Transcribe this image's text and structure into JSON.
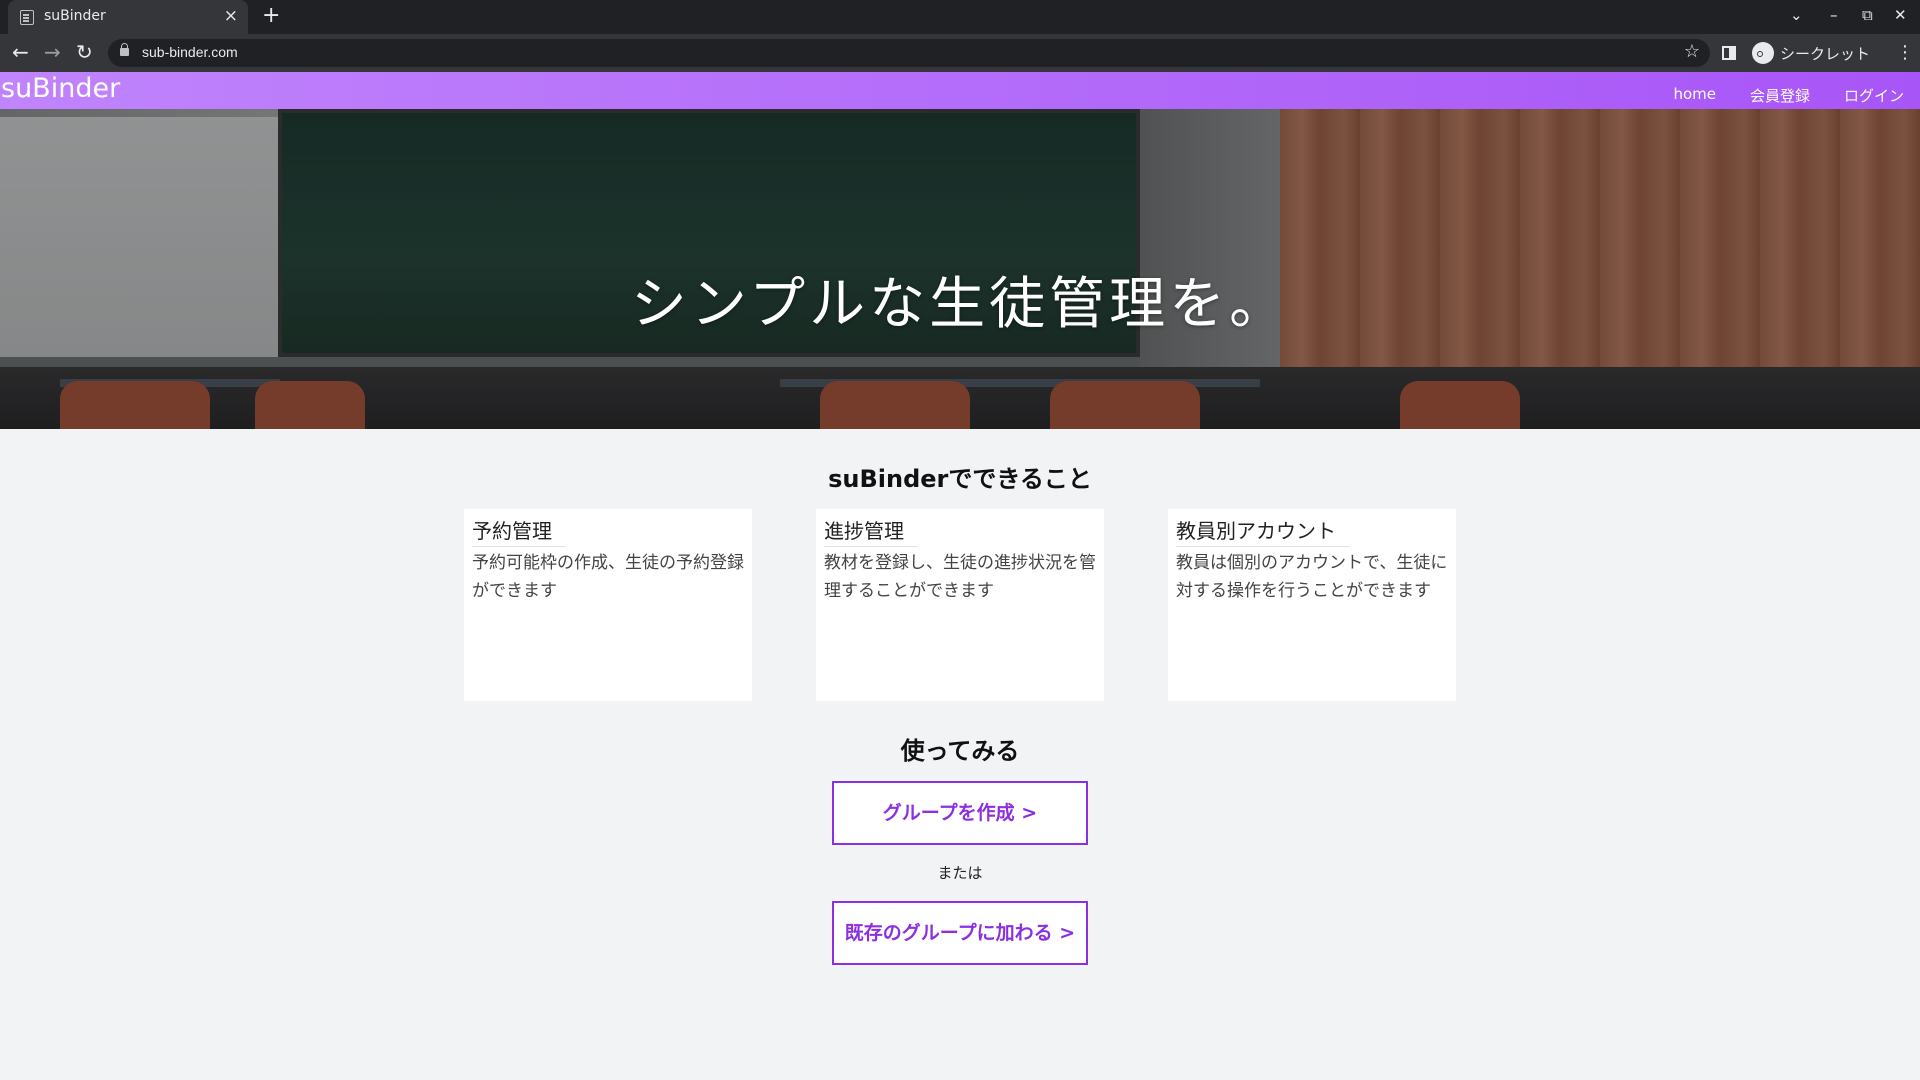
{
  "browser": {
    "tab_title": "suBinder",
    "tab_close": "×",
    "new_tab": "+",
    "url": "sub-binder.com",
    "profile_label": "シークレット",
    "window_controls": {
      "dropdown": "⌄",
      "minimize": "–",
      "restore": "⧉",
      "close": "✕"
    },
    "nav": {
      "back": "←",
      "forward": "→",
      "reload": "↻",
      "star": "☆",
      "menu": "⋮"
    }
  },
  "site": {
    "logo": "suBinder",
    "nav": [
      {
        "label": "home"
      },
      {
        "label": "会員登録"
      },
      {
        "label": "ログイン"
      }
    ],
    "brand_colors": {
      "header_start": "#c084fc",
      "header_end": "#a855f7",
      "accent": "#8b2fe0"
    }
  },
  "hero": {
    "title": "シンプルな生徒管理を。"
  },
  "features": {
    "title": "suBinderでできること",
    "cards": [
      {
        "title": "予約管理",
        "description": "予約可能枠の作成、生徒の予約登録ができます"
      },
      {
        "title": "進捗管理",
        "description": "教材を登録し、生徒の進捗状況を管理することができます"
      },
      {
        "title": "教員別アカウント",
        "description": "教員は個別のアカウントで、生徒に対する操作を行うことができます"
      }
    ]
  },
  "try": {
    "title": "使ってみる",
    "create_button": "グループを作成 >",
    "or_text": "または",
    "join_button": "既存のグループに加わる >"
  }
}
